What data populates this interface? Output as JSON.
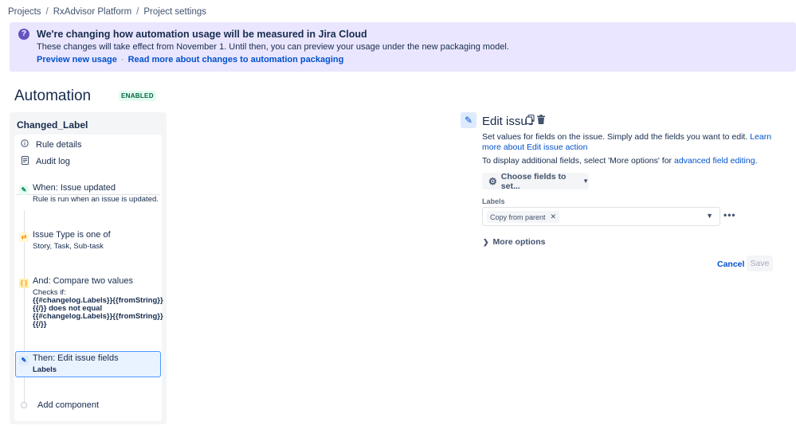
{
  "breadcrumb": {
    "items": [
      "Projects",
      "RxAdvisor Platform",
      "Project settings"
    ],
    "separator": "/"
  },
  "banner": {
    "title": "We're changing how automation usage will be measured in Jira Cloud",
    "body": "These changes will take effect from November 1. Until then, you can preview your usage under the new packaging model.",
    "link1": "Preview new usage",
    "separator": "·",
    "link2": "Read more about changes to automation packaging",
    "icon": "question-icon",
    "color": "#eae6ff"
  },
  "page": {
    "title": "Automation",
    "status": "ENABLED"
  },
  "rule": {
    "name": "Changed_Label",
    "menu": [
      {
        "label": "Rule details",
        "icon": "info-icon"
      },
      {
        "label": "Audit log",
        "icon": "document-icon"
      }
    ],
    "steps": [
      {
        "title": "When: Issue updated",
        "desc": "Rule is run when an issue is updated.",
        "icon": "pencil-icon"
      },
      {
        "title": "Issue Type is one of",
        "desc": "Story, Task, Sub-task",
        "icon": "shuffle-icon"
      },
      {
        "title": "And: Compare two values",
        "desc_lines": [
          "Checks if:",
          "{{#changelog.Labels}}{{fromString}}",
          "{{/}} does not equal",
          "{{#changelog.Labels}}{{fromString}}",
          "{{/}}"
        ],
        "icon": "braces-icon"
      },
      {
        "title": "Then: Edit issue fields",
        "desc": "Labels",
        "icon": "pencil-icon"
      }
    ],
    "add_component": "Add component"
  },
  "editor": {
    "title": "Edit issue",
    "desc_text": "Set values for fields on the issue. Simply add the fields you want to edit.",
    "desc_link": "Learn more about Edit issue action",
    "desc2_text": "To display additional fields, select 'More options' for",
    "desc2_link": "advanced field editing",
    "desc2_end": ".",
    "choose_fields": "Choose fields to set...",
    "labels_label": "Labels",
    "labels_value": "Copy from parent",
    "more_options": "More options",
    "cancel": "Cancel",
    "save": "Save"
  },
  "colors": {
    "accent": "#0052cc",
    "enabled_bg": "#e3fcef",
    "enabled_text": "#006644"
  }
}
